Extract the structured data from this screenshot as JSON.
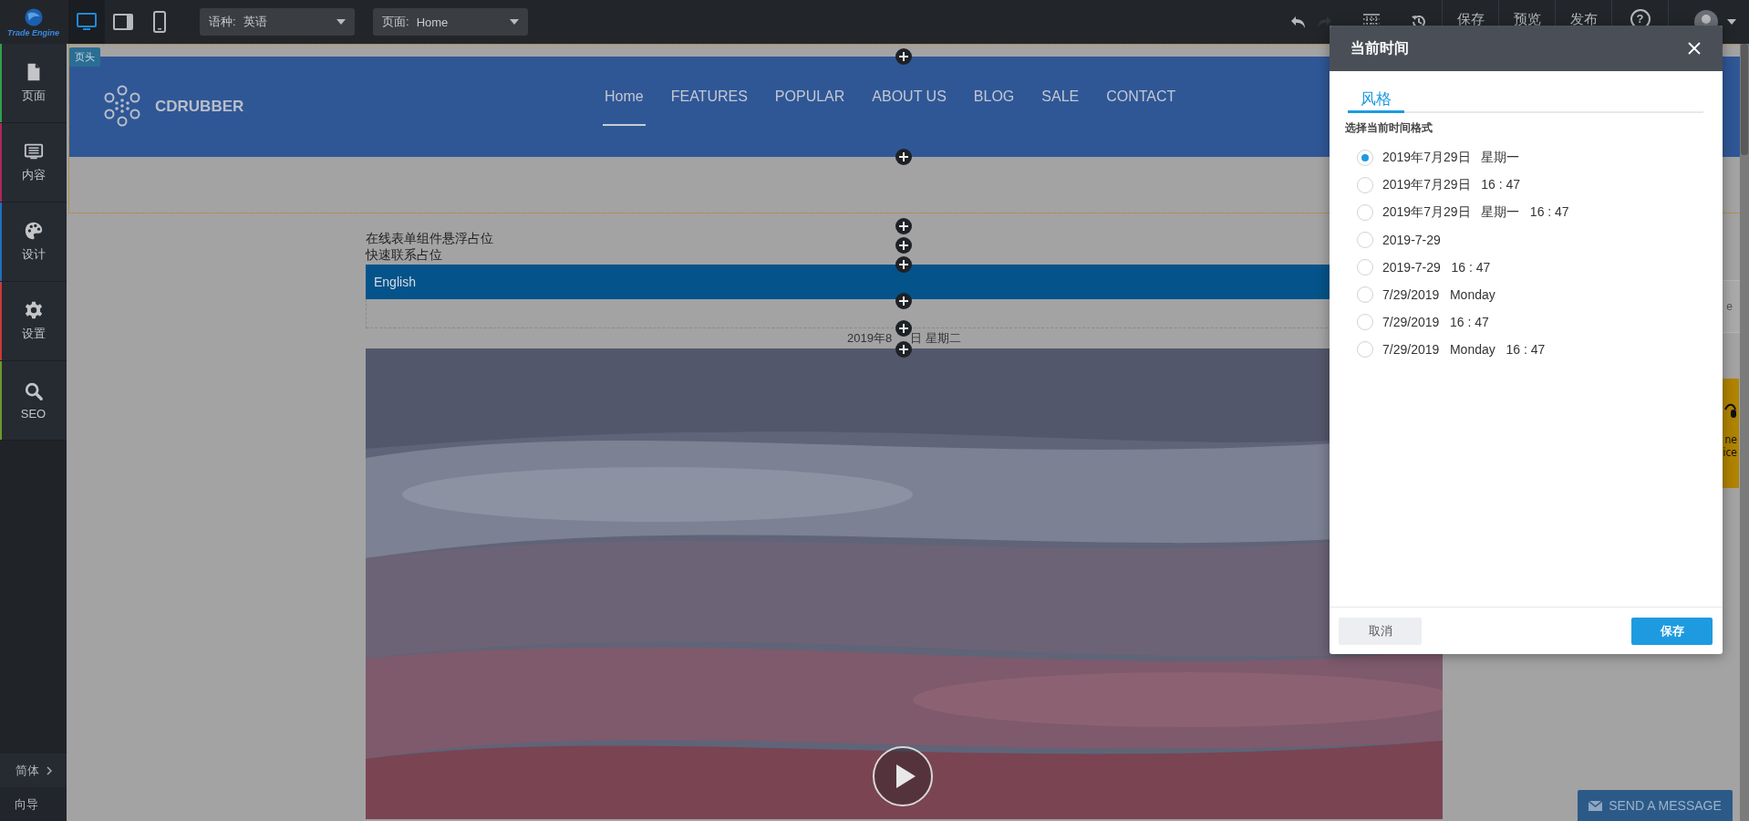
{
  "toolbar": {
    "logo_text": "Trade Engine",
    "device_modes": [
      {
        "kind": "desktop",
        "selected": true
      },
      {
        "kind": "tablet",
        "selected": false
      },
      {
        "kind": "phone",
        "selected": false
      }
    ],
    "language_select": {
      "label": "语种:",
      "value": "英语"
    },
    "page_select": {
      "label": "页面:",
      "value": "Home"
    },
    "actions": [
      {
        "kind": "undo",
        "disabled": false
      },
      {
        "kind": "redo",
        "disabled": true
      },
      {
        "kind": "grid",
        "disabled": false
      },
      {
        "kind": "history",
        "disabled": false
      },
      {
        "kind": "text",
        "label": "保存",
        "disabled": false
      },
      {
        "kind": "text",
        "label": "预览",
        "disabled": false
      },
      {
        "kind": "text",
        "label": "发布",
        "disabled": false
      },
      {
        "kind": "help",
        "label": "?",
        "disabled": false
      },
      {
        "kind": "avatar",
        "disabled": false
      }
    ]
  },
  "sidebar": {
    "items": [
      {
        "kind": "page",
        "label": "页面",
        "color": "#2fa04e"
      },
      {
        "kind": "content",
        "label": "内容",
        "color": "#b0285a"
      },
      {
        "kind": "design",
        "label": "设计",
        "color": "#1f6fc0"
      },
      {
        "kind": "settings",
        "label": "设置",
        "color": "#c83a3a"
      },
      {
        "kind": "seo",
        "label": "SEO",
        "color": "#6a9a2a"
      }
    ],
    "footer": [
      {
        "kind": "language",
        "label": "简体"
      },
      {
        "kind": "guide",
        "label": "向导"
      }
    ]
  },
  "canvas": {
    "section_tag": "页头",
    "site_header": {
      "brand": "CDRUBBER",
      "nav": [
        {
          "label": "Home",
          "selected": true
        },
        {
          "label": "FEATURES",
          "selected": false
        },
        {
          "label": "POPULAR",
          "selected": false
        },
        {
          "label": "ABOUT US",
          "selected": false
        },
        {
          "label": "BLOG",
          "selected": false
        },
        {
          "label": "SALE",
          "selected": false
        },
        {
          "label": "CONTACT",
          "selected": false
        }
      ]
    },
    "placeholders": [
      "在线表单组件悬浮占位",
      "快速联系占位"
    ],
    "language_bar": "English",
    "date": {
      "before": "2019年8",
      "after": "日  星期二"
    },
    "video": {
      "kind": "picture"
    },
    "side_panel_text": "e",
    "side_widget": {
      "lines": [
        "ne",
        "ice"
      ]
    },
    "send_message": "SEND A MESSAGE"
  },
  "dialog": {
    "title": "当前时间",
    "tabs": [
      {
        "label": "风格",
        "selected": true
      }
    ],
    "prompt": "选择当前时间格式",
    "options": [
      {
        "label": "2019年7月29日   星期一",
        "selected": true
      },
      {
        "label": "2019年7月29日   16 : 47",
        "selected": false
      },
      {
        "label": "2019年7月29日   星期一   16 : 47",
        "selected": false
      },
      {
        "label": "2019-7-29",
        "selected": false
      },
      {
        "label": "2019-7-29   16 : 47",
        "selected": false
      },
      {
        "label": "7/29/2019   Monday",
        "selected": false
      },
      {
        "label": "7/29/2019   16 : 47",
        "selected": false
      },
      {
        "label": "7/29/2019   Monday   16 : 47",
        "selected": false
      }
    ],
    "buttons": [
      {
        "kind": "cancel",
        "label": "取消"
      },
      {
        "kind": "primary",
        "label": "保存"
      }
    ]
  }
}
